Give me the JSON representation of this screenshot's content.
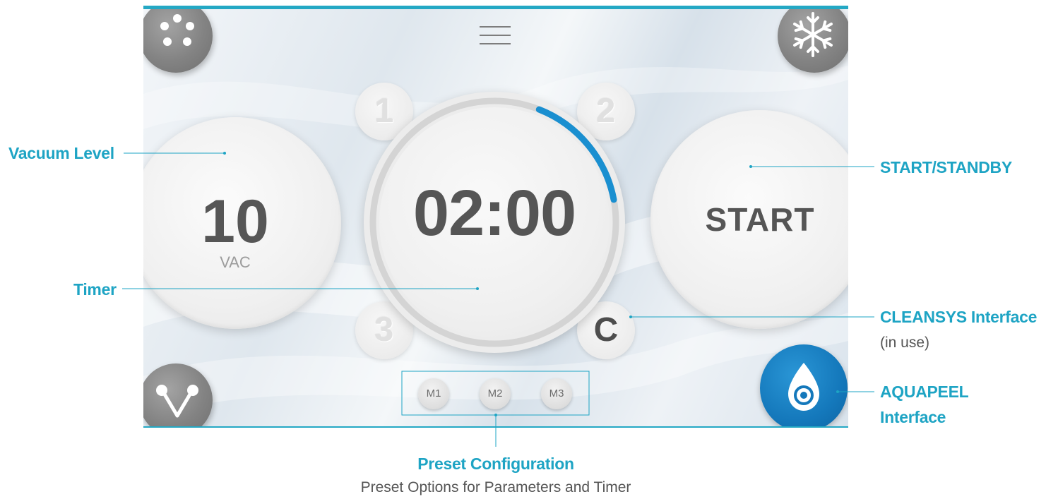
{
  "screen": {
    "timer": "02:00",
    "timer_progress": 0.16,
    "vacuum": {
      "value": "10",
      "unit": "VAC"
    },
    "start_button": "START",
    "presets": [
      "1",
      "2",
      "3",
      "C"
    ],
    "active_preset": "C",
    "memory_presets": [
      "M1",
      "M2",
      "M3"
    ],
    "icons": {
      "top_left": "dots-circle-icon",
      "top_right": "snowflake-icon",
      "bottom_left": "v-shape-icon",
      "bottom_right": "water-drop-icon",
      "menu": "hamburger-menu-icon"
    },
    "colors": {
      "accent": "#1ea4c4",
      "aquapeel": "#1478bb",
      "progress": "#1a8fd0"
    }
  },
  "callouts": {
    "vacuum_level": "Vacuum Level",
    "timer": "Timer",
    "start_standby": "START/STANDBY",
    "cleansys_title": "CLEANSYS Interface",
    "cleansys_sub": "(in use)",
    "aquapeel_line1": "AQUAPEEL",
    "aquapeel_line2": "Interface",
    "preset_title": "Preset Configuration",
    "preset_sub": "Preset Options for Parameters and Timer"
  }
}
